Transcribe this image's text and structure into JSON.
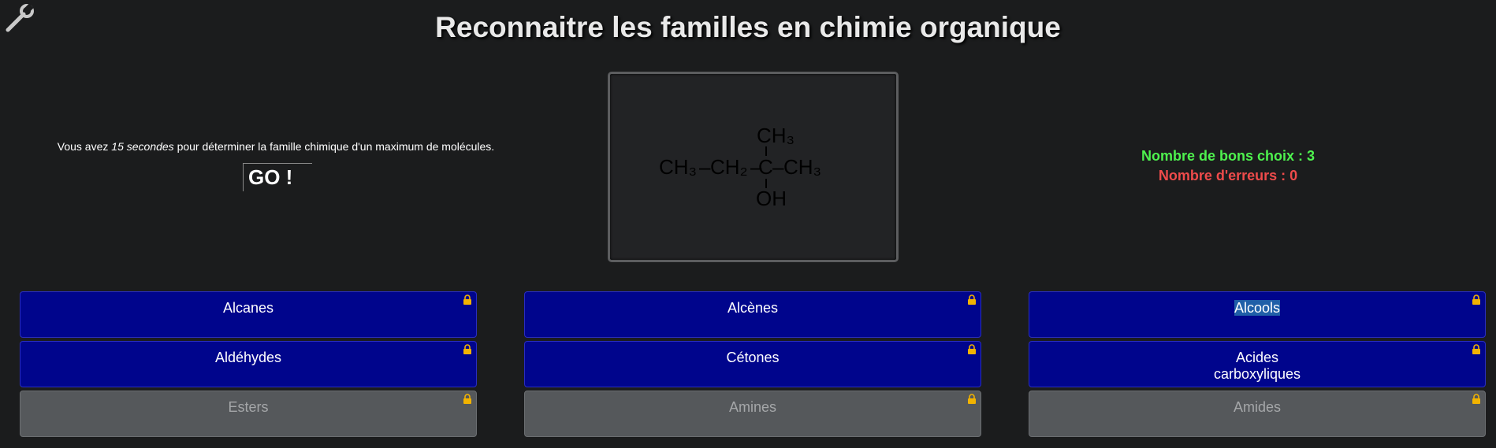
{
  "header": {
    "title": "Reconnaitre les familles en chimie organique"
  },
  "intro": {
    "prefix": "Vous avez ",
    "duration": "15 secondes",
    "suffix": " pour déterminer la famille chimique d'un maximum de molécules.",
    "go_label": "GO !"
  },
  "molecule": {
    "chain": [
      "CH₃",
      "–",
      "CH₂",
      "–",
      "C",
      "–",
      "CH₃"
    ],
    "top_group": "CH₃",
    "bottom_group": "OH"
  },
  "scores": {
    "good_label": "Nombre de bons choix : 3",
    "errors_label": "Nombre d'erreurs : 0"
  },
  "choices": [
    {
      "label": "Alcanes",
      "state": "active"
    },
    {
      "label": "Alcènes",
      "state": "active"
    },
    {
      "label": "Alcools",
      "state": "active"
    },
    {
      "label": "Aldéhydes",
      "state": "active"
    },
    {
      "label": "Cétones",
      "state": "active"
    },
    {
      "label": "Acides carboxyliques",
      "line1": "Acides",
      "line2": "carboxyliques",
      "state": "active"
    },
    {
      "label": "Esters",
      "state": "locked"
    },
    {
      "label": "Amines",
      "state": "locked"
    },
    {
      "label": "Amides",
      "state": "locked"
    }
  ],
  "colors": {
    "background": "#1b1c1d",
    "choice_active": "#00058c",
    "choice_locked": "#55585b",
    "good": "#4ef24e",
    "bad": "#ef4b4b",
    "lock": "#f2b300"
  },
  "icons": {
    "tool": "wrench-icon",
    "lock": "lock-icon"
  }
}
